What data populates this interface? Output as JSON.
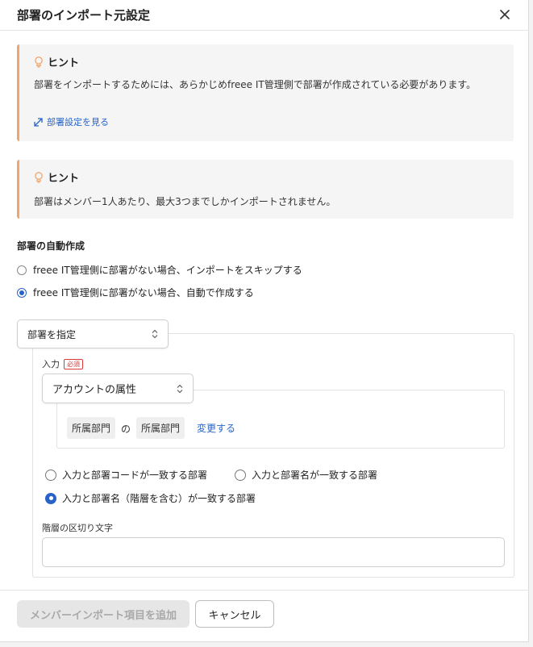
{
  "dialog": {
    "title": "部署のインポート元設定"
  },
  "hint1": {
    "title": "ヒント",
    "text": "部署をインポートするためには、あらかじめfreee IT管理側で部署が作成されている必要があります。",
    "link": "部署設定を見る"
  },
  "hint2": {
    "title": "ヒント",
    "text": "部署はメンバー1人あたり、最大3つまでしかインポートされません。"
  },
  "auto_create": {
    "label": "部署の自動作成",
    "options": [
      {
        "label": "freee IT管理側に部署がない場合、インポートをスキップする",
        "selected": false
      },
      {
        "label": "freee IT管理側に部署がない場合、自動で作成する",
        "selected": true
      }
    ]
  },
  "dept_select": {
    "value": "部署を指定"
  },
  "input": {
    "label": "入力",
    "required_badge": "必須",
    "source_select": "アカウントの属性",
    "attribute_chip": "所属部門",
    "connector": "の",
    "mapped_chip": "所属部門",
    "change_link": "変更する"
  },
  "match_options": [
    {
      "label": "入力と部署コードが一致する部署",
      "selected": false
    },
    {
      "label": "入力と部署名が一致する部署",
      "selected": false
    },
    {
      "label": "入力と部署名（階層を含む）が一致する部署",
      "selected": true
    }
  ],
  "separator": {
    "label": "階層の区切り文字",
    "value": ""
  },
  "footer": {
    "add_button": "メンバーインポート項目を追加",
    "cancel_button": "キャンセル"
  },
  "colors": {
    "accent": "#2864c8",
    "hint_border": "#f2a56b",
    "required": "#d83a3a"
  }
}
